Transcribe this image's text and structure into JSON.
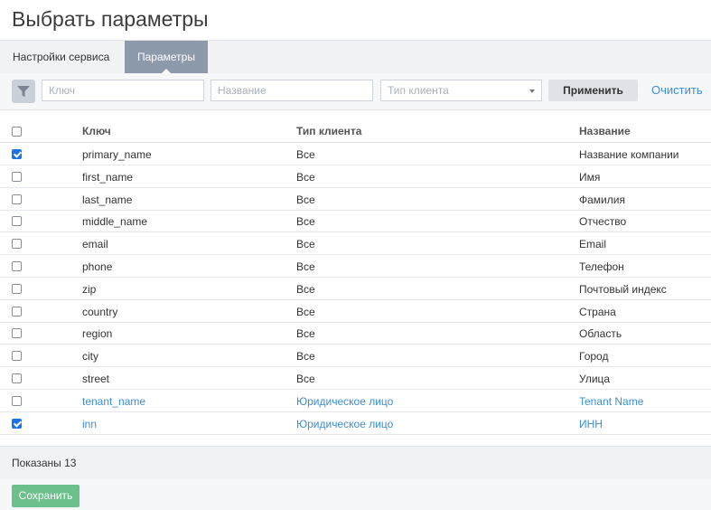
{
  "page": {
    "title": "Выбрать параметры"
  },
  "tabs": [
    {
      "label": "Настройки сервиса",
      "active": false
    },
    {
      "label": "Параметры",
      "active": true
    }
  ],
  "filters": {
    "key_placeholder": "Ключ",
    "name_placeholder": "Название",
    "client_type_placeholder": "Тип клиента",
    "apply_label": "Применить",
    "clear_label": "Очистить"
  },
  "table": {
    "columns": {
      "key": "Ключ",
      "client_type": "Тип клиента",
      "name": "Название"
    },
    "rows": [
      {
        "checked": true,
        "key": "primary_name",
        "client_type": "Все",
        "name": "Название компании",
        "link": false
      },
      {
        "checked": false,
        "key": "first_name",
        "client_type": "Все",
        "name": "Имя",
        "link": false
      },
      {
        "checked": false,
        "key": "last_name",
        "client_type": "Все",
        "name": "Фамилия",
        "link": false
      },
      {
        "checked": false,
        "key": "middle_name",
        "client_type": "Все",
        "name": "Отчество",
        "link": false
      },
      {
        "checked": false,
        "key": "email",
        "client_type": "Все",
        "name": "Email",
        "link": false
      },
      {
        "checked": false,
        "key": "phone",
        "client_type": "Все",
        "name": "Телефон",
        "link": false
      },
      {
        "checked": false,
        "key": "zip",
        "client_type": "Все",
        "name": "Почтовый индекс",
        "link": false
      },
      {
        "checked": false,
        "key": "country",
        "client_type": "Все",
        "name": "Страна",
        "link": false
      },
      {
        "checked": false,
        "key": "region",
        "client_type": "Все",
        "name": "Область",
        "link": false
      },
      {
        "checked": false,
        "key": "city",
        "client_type": "Все",
        "name": "Город",
        "link": false
      },
      {
        "checked": false,
        "key": "street",
        "client_type": "Все",
        "name": "Улица",
        "link": false
      },
      {
        "checked": false,
        "key": "tenant_name",
        "client_type": "Юридическое лицо",
        "name": "Tenant Name",
        "link": true
      },
      {
        "checked": true,
        "key": "inn",
        "client_type": "Юридическое лицо",
        "name": "ИНН",
        "link": true
      }
    ]
  },
  "footer": {
    "count_label": "Показаны 13"
  },
  "actions": {
    "save_label": "Сохранить"
  },
  "colors": {
    "accent": "#3d8ed8",
    "tab_active": "#8c9aac",
    "save": "#6cc08b",
    "checkbox": "#1a73e8"
  },
  "icons": {
    "filter": "filter-icon",
    "dropdown": "chevron-down-icon"
  }
}
